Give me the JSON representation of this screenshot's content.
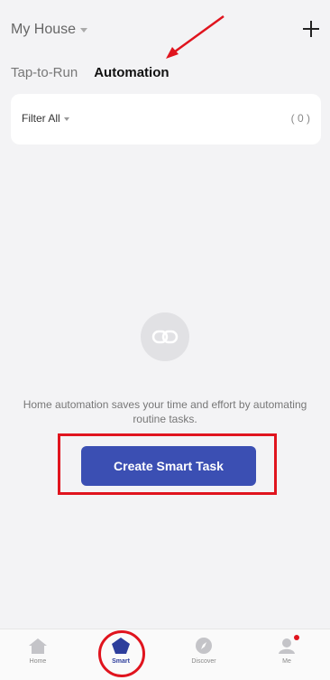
{
  "header": {
    "house_name": "My House",
    "add_icon": "plus-icon"
  },
  "tabs": [
    {
      "label": "Tap-to-Run",
      "active": false
    },
    {
      "label": "Automation",
      "active": true
    }
  ],
  "filter": {
    "label": "Filter All",
    "count": "( 0 )"
  },
  "empty_state": {
    "icon": "link-icon",
    "message": "Home automation saves your time and effort by automating routine tasks.",
    "button_label": "Create Smart Task"
  },
  "annotations": {
    "color": "#e0141e"
  },
  "bottom_nav": [
    {
      "label": "Home",
      "icon": "home-icon",
      "active": false
    },
    {
      "label": "Smart",
      "icon": "pentagon-icon",
      "active": true
    },
    {
      "label": "Discover",
      "icon": "compass-icon",
      "active": false
    },
    {
      "label": "Me",
      "icon": "user-icon",
      "active": false
    }
  ],
  "colors": {
    "accent": "#3b4fb3",
    "background": "#f3f3f5"
  }
}
